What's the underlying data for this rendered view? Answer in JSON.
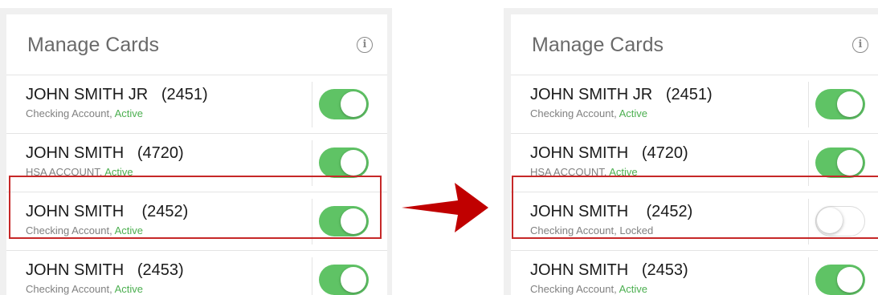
{
  "left": {
    "title": "Manage Cards",
    "cards": [
      {
        "name": "JOHN SMITH JR   (2451)",
        "type": "Checking Account,",
        "status": "Active",
        "enabled": true
      },
      {
        "name": "JOHN SMITH   (4720)",
        "type": "HSA ACCOUNT,",
        "status": "Active",
        "enabled": true
      },
      {
        "name": "JOHN SMITH    (2452)",
        "type": "Checking Account,",
        "status": "Active",
        "enabled": true
      },
      {
        "name": "JOHN SMITH   (2453)",
        "type": "Checking Account,",
        "status": "Active",
        "enabled": true
      }
    ]
  },
  "right": {
    "title": "Manage Cards",
    "cards": [
      {
        "name": "JOHN SMITH JR   (2451)",
        "type": "Checking Account,",
        "status": "Active",
        "enabled": true
      },
      {
        "name": "JOHN SMITH   (4720)",
        "type": "HSA ACCOUNT,",
        "status": "Active",
        "enabled": true
      },
      {
        "name": "JOHN SMITH    (2452)",
        "type": "Checking Account,",
        "status": "Locked",
        "enabled": false
      },
      {
        "name": "JOHN SMITH   (2453)",
        "type": "Checking Account,",
        "status": "Active",
        "enabled": true
      }
    ]
  },
  "colors": {
    "toggle_on": "#5fc365",
    "active_status": "#4caf50",
    "highlight": "#c62828",
    "arrow": "#c00000"
  },
  "icons": {
    "info": "info-circle-icon",
    "arrow": "right-arrow-icon"
  }
}
